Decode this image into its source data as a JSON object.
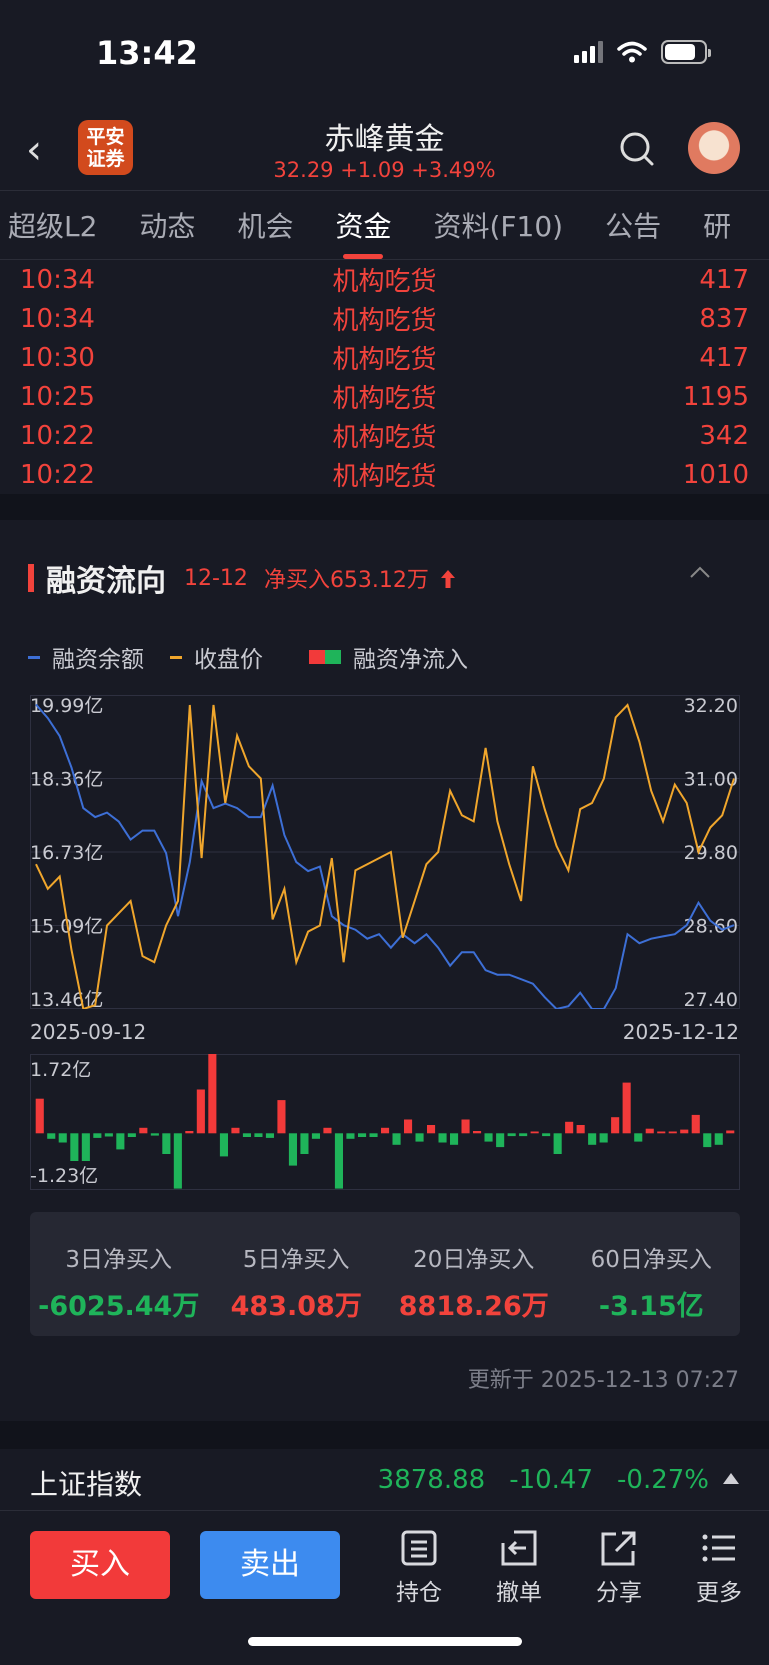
{
  "status": {
    "time": "13:42"
  },
  "header": {
    "logo": [
      "平安",
      "证券"
    ],
    "title": "赤峰黄金",
    "quote": "32.29  +1.09  +3.49%"
  },
  "tabs": [
    "超级L2",
    "动态",
    "机会",
    "资金",
    "资料(F10)",
    "公告",
    "研"
  ],
  "active_tab": "资金",
  "trades": [
    {
      "time": "10:34",
      "type": "机构吃货",
      "volume": "417"
    },
    {
      "time": "10:34",
      "type": "机构吃货",
      "volume": "837"
    },
    {
      "time": "10:30",
      "type": "机构吃货",
      "volume": "417"
    },
    {
      "time": "10:25",
      "type": "机构吃货",
      "volume": "1195"
    },
    {
      "time": "10:22",
      "type": "机构吃货",
      "volume": "342"
    },
    {
      "time": "10:22",
      "type": "机构吃货",
      "volume": "1010"
    }
  ],
  "financing": {
    "title": "融资流向",
    "date": "12-12",
    "net_buy": "净买入653.12万",
    "legend": [
      "融资余额",
      "收盘价",
      "融资净流入"
    ],
    "date_start": "2025-09-12",
    "date_end": "2025-12-12",
    "summary": [
      {
        "label": "3日净买入",
        "value": "-6025.44万"
      },
      {
        "label": "5日净买入",
        "value": "483.08万"
      },
      {
        "label": "20日净买入",
        "value": "8818.26万"
      },
      {
        "label": "60日净买入",
        "value": "-3.15亿"
      }
    ],
    "updated": "更新于 2025-12-13 07:27"
  },
  "chart_data": [
    {
      "type": "line",
      "title": "",
      "x": [
        "2025-09-12",
        "2025-12-12"
      ],
      "left_ticks": [
        "19.99亿",
        "18.36亿",
        "16.73亿",
        "15.09亿",
        "13.46亿"
      ],
      "right_ticks": [
        "32.20",
        "31.00",
        "29.80",
        "28.60",
        "27.40"
      ],
      "ylim_left": [
        13.46,
        19.99
      ],
      "ylim_right": [
        27.4,
        32.2
      ],
      "series": [
        {
          "name": "融资余额",
          "color": "#3d6fd6",
          "axis": "left",
          "values": [
            20.0,
            19.7,
            19.3,
            18.6,
            17.7,
            17.5,
            17.6,
            17.4,
            17.0,
            17.2,
            17.2,
            16.7,
            15.3,
            16.5,
            18.3,
            17.7,
            17.8,
            17.7,
            17.5,
            17.5,
            18.2,
            17.1,
            16.5,
            16.3,
            16.4,
            15.3,
            15.1,
            15.0,
            14.8,
            14.9,
            14.6,
            14.9,
            14.7,
            14.9,
            14.6,
            14.2,
            14.5,
            14.5,
            14.1,
            14.0,
            14.0,
            13.9,
            13.8,
            13.5,
            12.9,
            13.3,
            13.6,
            13.2,
            13.1,
            13.7,
            14.9,
            14.7,
            14.8,
            14.85,
            14.9,
            15.1,
            15.6,
            15.2,
            15.0,
            15.1
          ]
        },
        {
          "name": "收盘价",
          "color": "#f0a62c",
          "axis": "right",
          "values": [
            29.6,
            29.2,
            29.4,
            28.2,
            27.1,
            27.3,
            28.6,
            28.8,
            29.0,
            28.1,
            28.0,
            28.6,
            29.0,
            32.2,
            29.7,
            32.2,
            30.6,
            31.7,
            31.2,
            31.0,
            28.7,
            29.2,
            28.0,
            28.5,
            28.6,
            29.7,
            28.0,
            29.5,
            29.6,
            29.7,
            29.8,
            28.4,
            29.0,
            29.6,
            29.8,
            30.8,
            30.4,
            30.3,
            31.5,
            30.3,
            29.6,
            29.0,
            31.2,
            30.5,
            29.9,
            29.5,
            30.5,
            30.6,
            31.0,
            32.0,
            32.2,
            31.6,
            30.8,
            30.3,
            30.9,
            30.6,
            29.8,
            30.2,
            30.4,
            31.0
          ]
        }
      ]
    },
    {
      "type": "bar",
      "title": "",
      "ylabel": "融资净流入",
      "ylim": [
        -1.23,
        1.72
      ],
      "ticks": [
        "1.72亿",
        "-1.23亿"
      ],
      "values": [
        0.75,
        -0.12,
        -0.2,
        -0.6,
        -0.6,
        -0.1,
        -0.07,
        -0.35,
        -0.08,
        0.12,
        -0.05,
        -0.45,
        -1.2,
        0.05,
        0.95,
        1.72,
        -0.5,
        0.12,
        -0.08,
        -0.08,
        -0.1,
        0.72,
        -0.7,
        -0.45,
        -0.12,
        0.12,
        -1.2,
        -0.12,
        -0.08,
        -0.08,
        0.12,
        -0.25,
        0.3,
        -0.18,
        0.18,
        -0.2,
        -0.25,
        0.3,
        0.05,
        -0.18,
        -0.3,
        -0.06,
        -0.06,
        0.04,
        -0.06,
        -0.45,
        0.25,
        0.18,
        -0.25,
        -0.2,
        0.35,
        1.1,
        -0.18,
        0.1,
        0.04,
        0.04,
        0.08,
        0.4,
        -0.3,
        -0.25,
        0.06
      ]
    }
  ],
  "index": {
    "name": "上证指数",
    "value": "3878.88",
    "change": "-10.47",
    "pct": "-0.27%"
  },
  "bottom": {
    "buy": "买入",
    "sell": "卖出",
    "tools": [
      "持仓",
      "撤单",
      "分享",
      "更多"
    ]
  }
}
